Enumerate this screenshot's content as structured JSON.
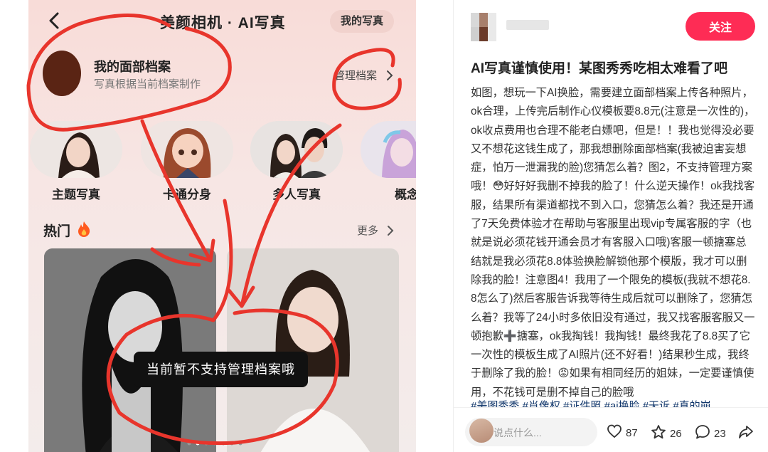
{
  "app": {
    "title": "美颜相机 · AI写真",
    "my_photos_label": "我的写真",
    "face_profile": {
      "title": "我的面部档案",
      "subtitle": "写真根据当前档案制作",
      "manage_label": "管理档案"
    },
    "categories": [
      {
        "label": "主题写真"
      },
      {
        "label": "卡通分身"
      },
      {
        "label": "多人写真"
      },
      {
        "label": "概念"
      }
    ],
    "hot_section": {
      "title": "热门",
      "more_label": "更多"
    },
    "toast": "当前暂不支持管理档案哦"
  },
  "post": {
    "follow_label": "关注",
    "title": "AI写真谨慎使用！某图秀秀吃相太难看了吧",
    "body": "如图，想玩一下AI换脸，需要建立面部档案上传各种照片，ok合理，上传完后制作心仪模板要8.8元(注意是一次性的)，ok收点费用也合理不能老白嫖吧，但是！！我也觉得没必要又不想花这钱生成了，那我想删除面部档案(我被迫害妄想症，怕万一泄漏我的脸)您猜怎么着？图2，不支持管理方案哦！😳好好好我删不掉我的脸了！什么逆天操作！ok我找客服，结果所有渠道都找不到入口，您猜怎么着？我还是开通了7天免费体验才在帮助与客服里出现vip专属客服的字（也就是说必须花钱开通会员才有客服入口哦)客服一顿搪塞总结就是我必须花8.8体验换脸解锁他那个模版，我才可以删除我的脸！注意图4！我用了一个限免的模板(我就不想花8.8怎么了)然后客服告诉我等待生成后就可以删除了，您猜怎么着？我等了24小时多依旧没有通过，我又找客服客服又一顿抱歉➕搪塞，ok我掏钱！我掏钱！最终我花了8.8买了它一次性的模板生成了AI照片(还不好看！)结果秒生成，我终于删除了我的脸！😡如果有相同经历的姐妹，一定要谨慎使用，不花钱可是删不掉自己的脸哦",
    "tags": "#美图秀秀 #肖像权 #证件照 #ai换脸 #天诉 #真的崩",
    "comment_placeholder": "说点什么...",
    "likes": "87",
    "favorites": "26",
    "comments": "23"
  },
  "colors": {
    "accent_red": "#fe2c55",
    "annotation_red": "#e8352c",
    "tag_blue": "#13386c"
  },
  "icons": [
    "back-icon",
    "chevron-right-icon",
    "flame-icon",
    "heart-icon",
    "star-icon",
    "comment-icon",
    "share-icon"
  ]
}
